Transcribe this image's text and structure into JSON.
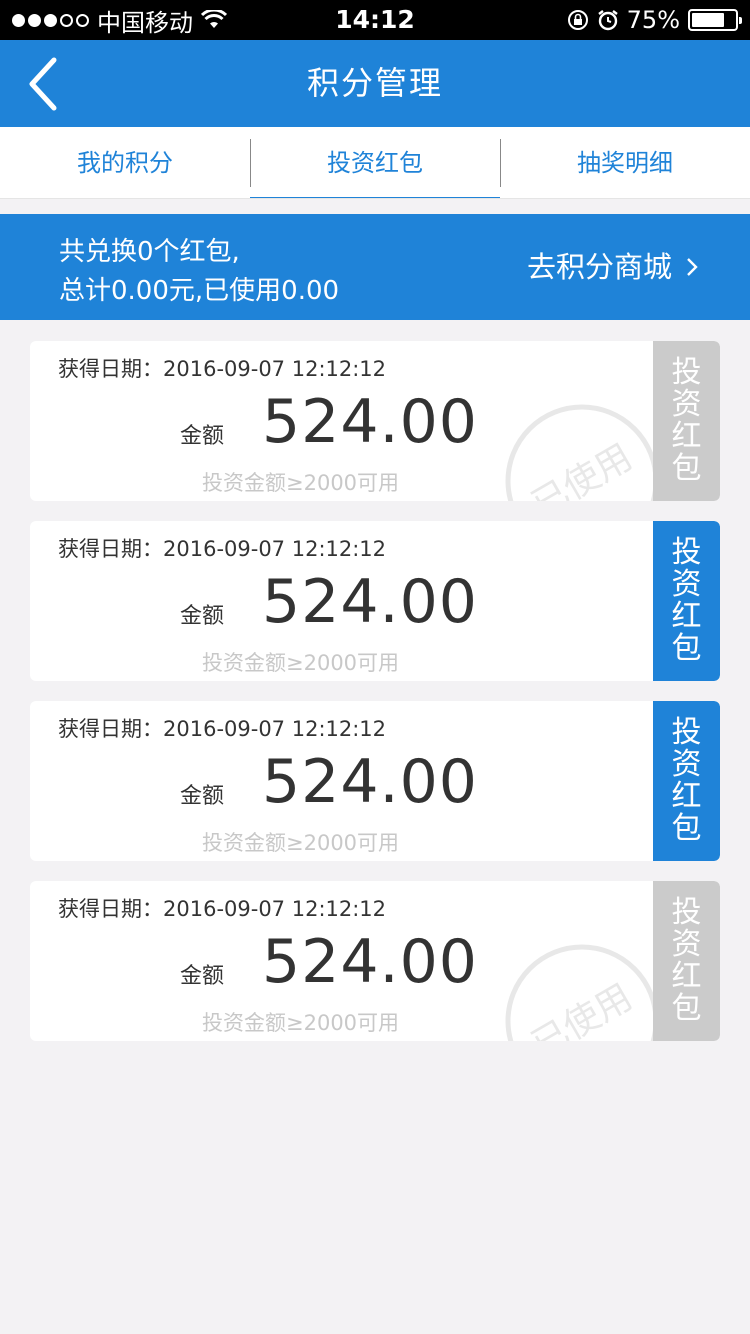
{
  "status": {
    "carrier": "中国移动",
    "time": "14:12",
    "battery": "75%",
    "battery_level": 0.75
  },
  "nav": {
    "title": "积分管理"
  },
  "tabs": [
    {
      "label": "我的积分"
    },
    {
      "label": "投资红包"
    },
    {
      "label": "抽奖明细"
    }
  ],
  "summary": {
    "line1": "共兑换0个红包,",
    "line2": "总计0.00元,已使用0.00",
    "mall_link": "去积分商城"
  },
  "cards": [
    {
      "date": "获得日期：2016-09-07 12:12:12",
      "amount_label": "金额",
      "amount": "524.00",
      "condition": "投资金额≥2000可用",
      "tag": [
        "投",
        "资",
        "红",
        "包"
      ],
      "status": "used",
      "stamp": "已使用"
    },
    {
      "date": "获得日期：2016-09-07 12:12:12",
      "amount_label": "金额",
      "amount": "524.00",
      "condition": "投资金额≥2000可用",
      "tag": [
        "投",
        "资",
        "红",
        "包"
      ],
      "status": "active"
    },
    {
      "date": "获得日期：2016-09-07 12:12:12",
      "amount_label": "金额",
      "amount": "524.00",
      "condition": "投资金额≥2000可用",
      "tag": [
        "投",
        "资",
        "红",
        "包"
      ],
      "status": "active"
    },
    {
      "date": "获得日期：2016-09-07 12:12:12",
      "amount_label": "金额",
      "amount": "524.00",
      "condition": "投资金额≥2000可用",
      "tag": [
        "投",
        "资",
        "红",
        "包"
      ],
      "status": "used",
      "stamp": "已使用"
    }
  ],
  "colors": {
    "primary": "#1f83d8",
    "used_tag": "#cbcbcb",
    "background": "#f3f2f4"
  }
}
